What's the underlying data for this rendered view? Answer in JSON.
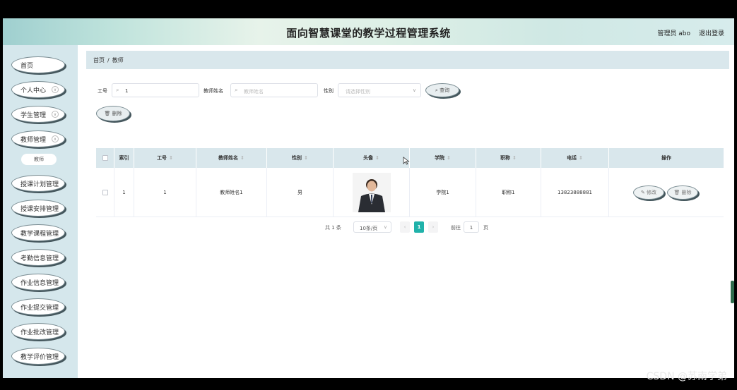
{
  "header": {
    "title": "面向智慧课堂的教学过程管理系统",
    "user_label": "管理员 abo",
    "logout_label": "退出登录"
  },
  "sidebar": {
    "items": [
      {
        "label": "首页"
      },
      {
        "label": "个人中心"
      },
      {
        "label": "学生管理"
      },
      {
        "label": "教师管理"
      },
      {
        "label": "授课计划管理"
      },
      {
        "label": "授课安排管理"
      },
      {
        "label": "教学课程管理"
      },
      {
        "label": "考勤信息管理"
      },
      {
        "label": "作业信息管理"
      },
      {
        "label": "作业提交管理"
      },
      {
        "label": "作业批改管理"
      },
      {
        "label": "教学评价管理"
      }
    ],
    "sub_item": "教师"
  },
  "breadcrumb": {
    "home": "首页",
    "separator": "/",
    "current": "教师"
  },
  "search": {
    "id_label": "工号",
    "id_value": "1",
    "name_label": "教师姓名",
    "name_placeholder": "教师姓名",
    "gender_label": "性别",
    "gender_placeholder": "请选择性别",
    "query_label": "查询"
  },
  "toolbar": {
    "delete_label": "删除"
  },
  "table": {
    "headers": [
      "索引",
      "工号",
      "教师姓名",
      "性别",
      "头像",
      "学院",
      "职称",
      "电话",
      "操作"
    ],
    "rows": [
      {
        "index": "1",
        "id": "1",
        "name": "教师姓名1",
        "gender": "男",
        "college": "学院1",
        "title": "职称1",
        "phone": "13823888881",
        "edit": "修改",
        "delete": "删除"
      }
    ]
  },
  "pagination": {
    "total": "共 1 条",
    "page_size": "10条/页",
    "current": "1",
    "goto_label": "前往",
    "goto_value": "1",
    "page_suffix": "页"
  },
  "watermark": "CSDN @苏南学弟",
  "colors": {
    "accent": "#20b2aa",
    "sidebar_bg": "#d5e7ec",
    "header_bg": "#d9e7ec"
  }
}
